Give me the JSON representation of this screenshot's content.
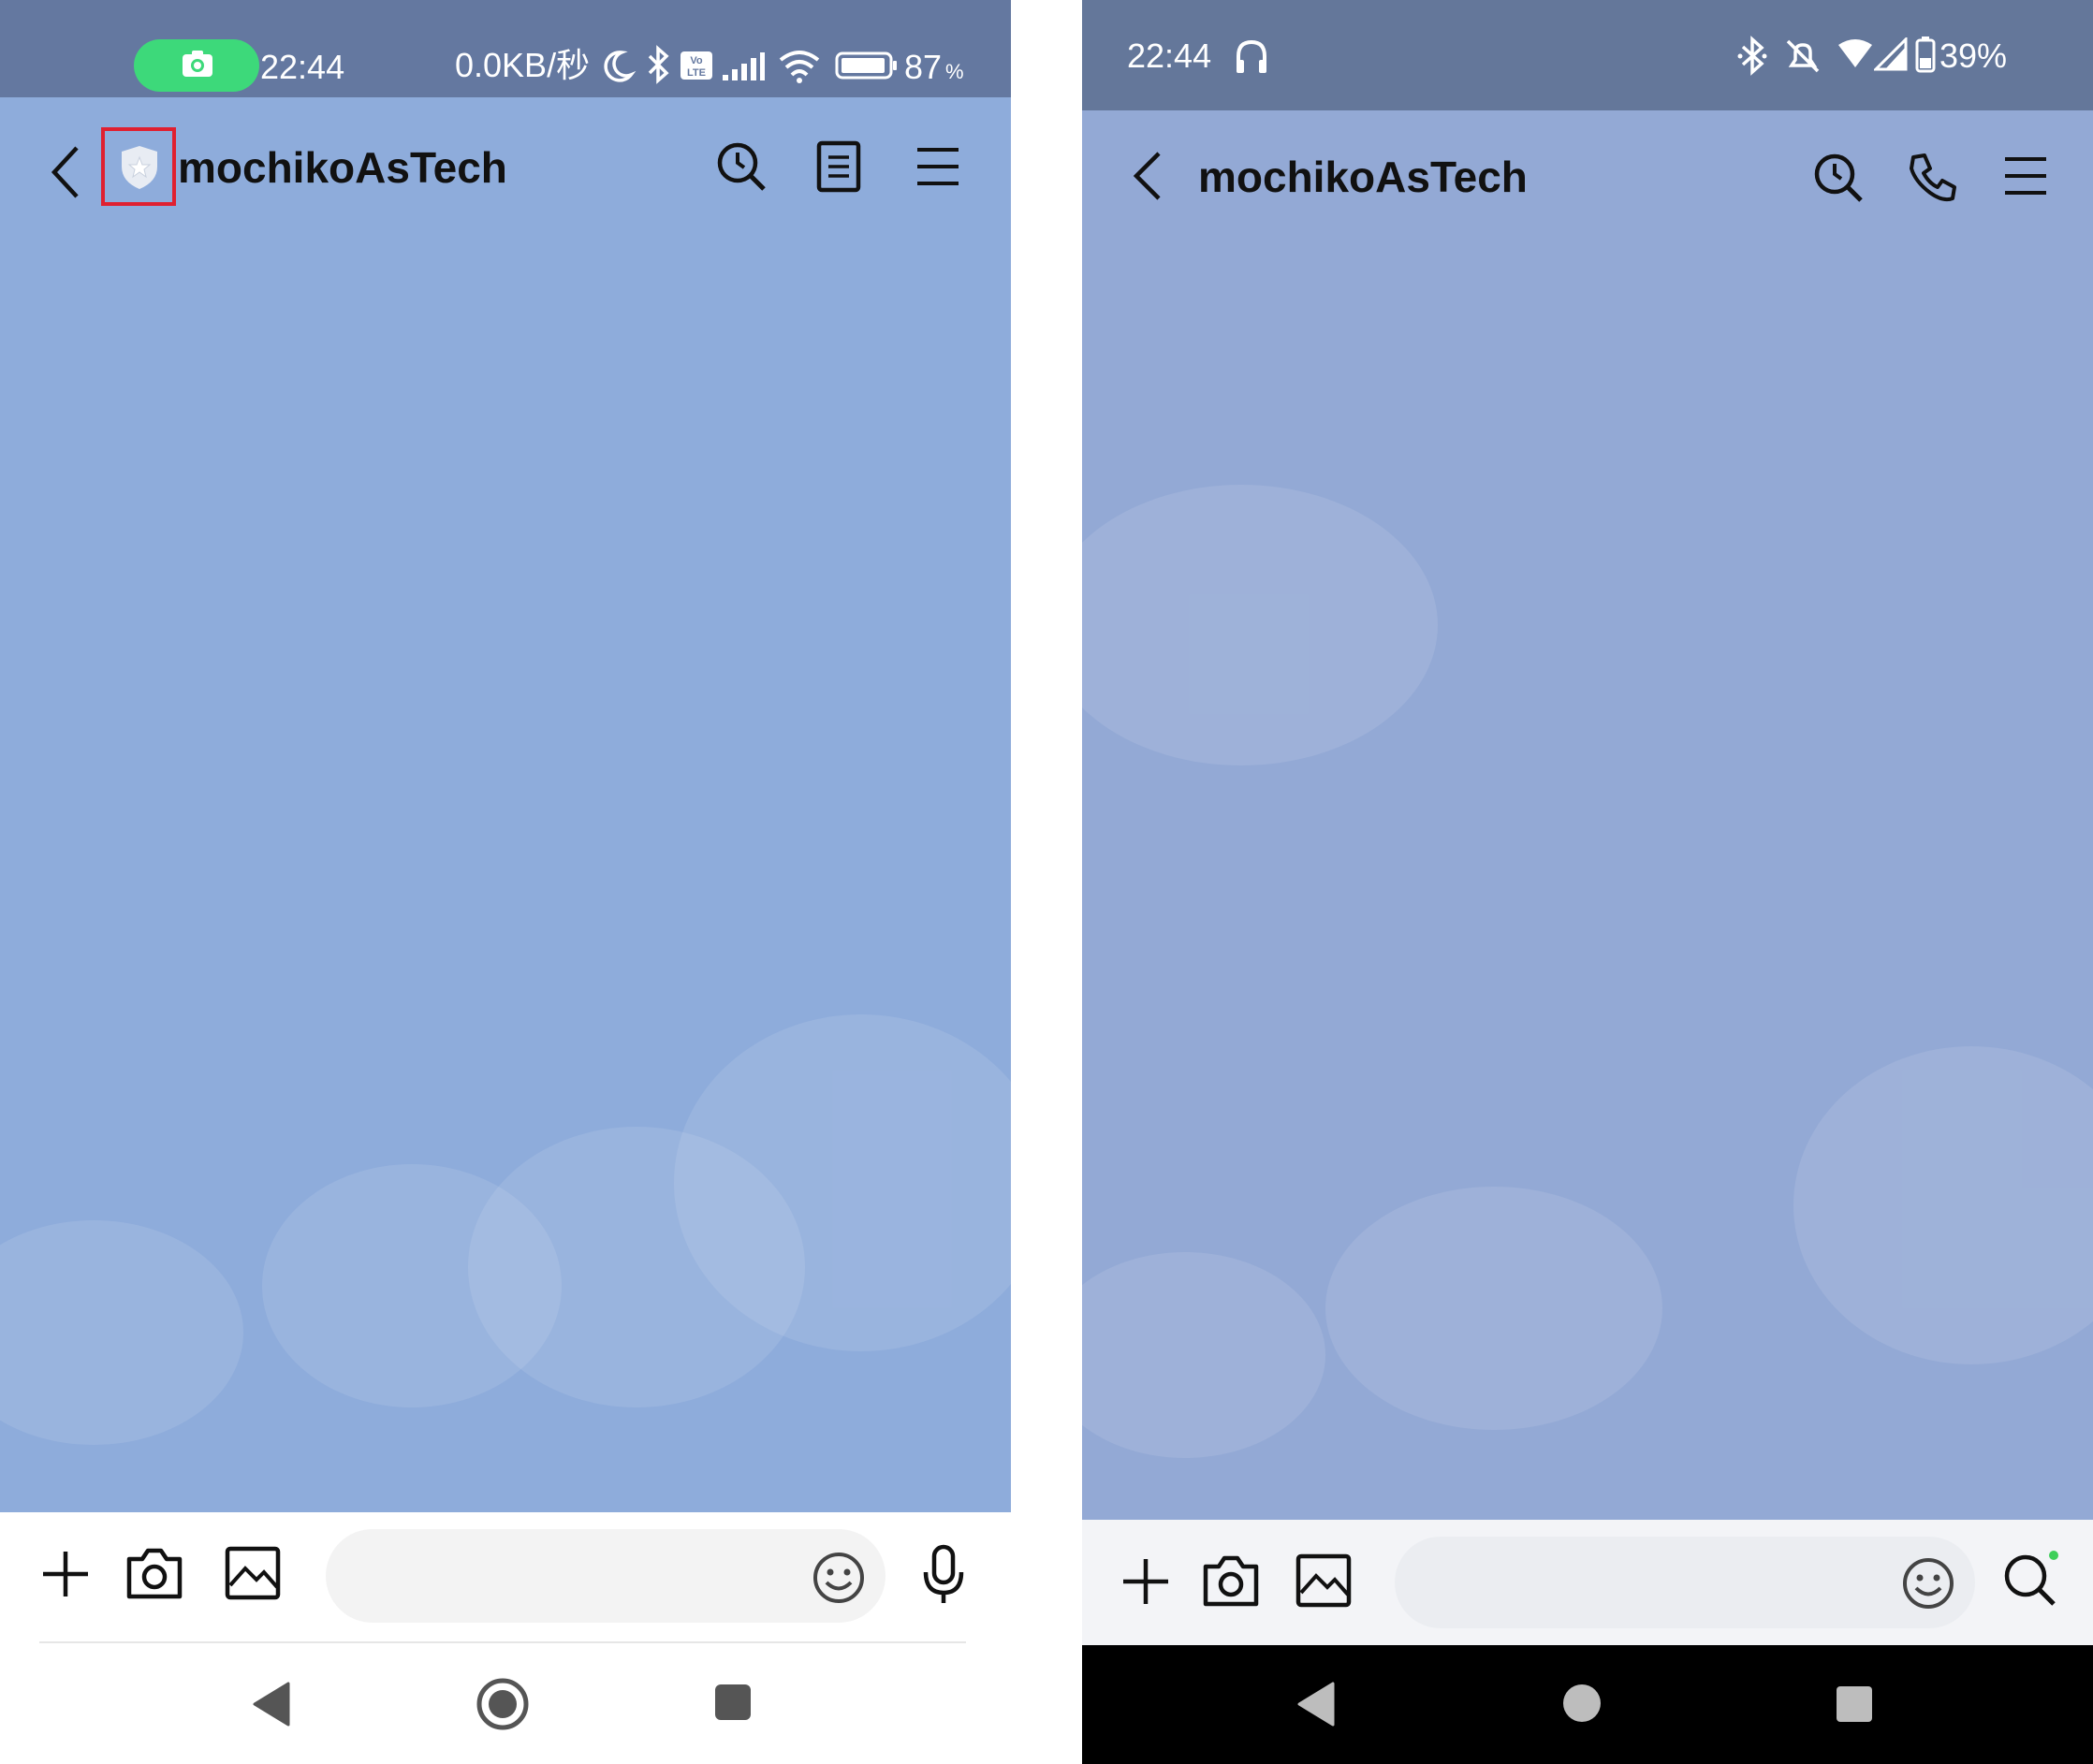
{
  "left_phone": {
    "status_bar": {
      "time": "22:44",
      "network_speed": "0.0KB/秒",
      "battery": "87",
      "battery_unit": "%"
    },
    "header": {
      "title": "mochikoAsTech"
    },
    "icons": {
      "back": "chevron-left-icon",
      "shield": "shield-star-icon",
      "search": "search-icon",
      "notes": "note-icon",
      "menu": "hamburger-menu-icon",
      "add": "plus-icon",
      "camera": "camera-icon",
      "image": "image-icon",
      "emoji": "emoji-icon",
      "mic": "microphone-icon"
    }
  },
  "right_phone": {
    "status_bar": {
      "time": "22:44",
      "battery": "39%"
    },
    "header": {
      "title": "mochikoAsTech"
    },
    "icons": {
      "back": "chevron-left-icon",
      "search": "search-icon",
      "call": "phone-icon",
      "menu": "hamburger-menu-icon",
      "add": "plus-icon",
      "camera": "camera-icon",
      "image": "image-icon",
      "emoji": "emoji-icon",
      "search_bottom": "search-icon"
    }
  },
  "colors": {
    "chat_bg_left": "#8eacdb",
    "chat_bg_right": "#93a9d5",
    "status_left": "#6478a0",
    "status_right": "#64779a",
    "highlight": "#e02030",
    "record_pill": "#3dd97a",
    "online_dot": "#3ecf5a"
  }
}
